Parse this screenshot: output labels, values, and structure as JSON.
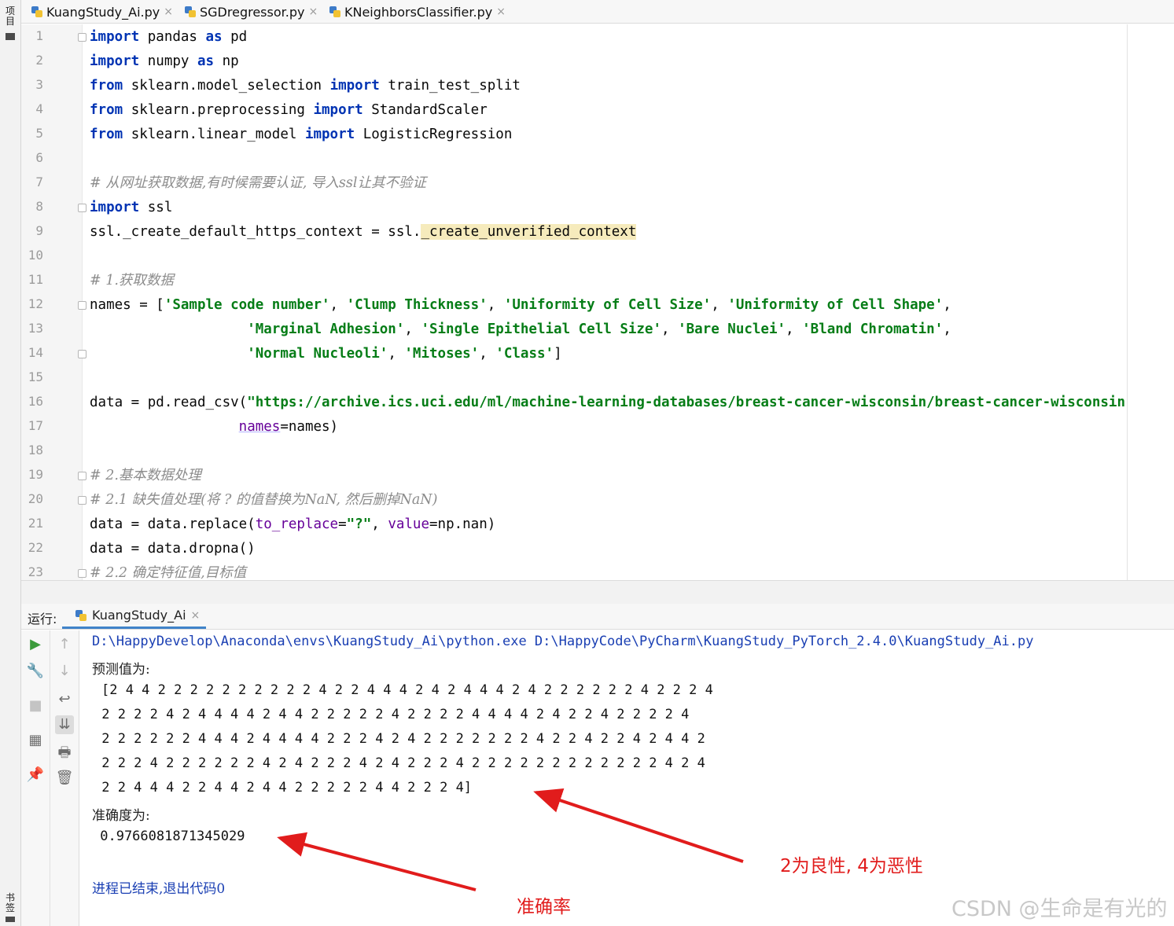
{
  "left_strip": {
    "top_label": "项目",
    "bottom_label": "书签"
  },
  "tabs": [
    {
      "label": "KuangStudy_Ai.py",
      "close": "×"
    },
    {
      "label": "SGDregressor.py",
      "close": "×"
    },
    {
      "label": "KNeighborsClassifier.py",
      "close": "×"
    }
  ],
  "editor": {
    "line_numbers": [
      "1",
      "2",
      "3",
      "4",
      "5",
      "6",
      "7",
      "8",
      "9",
      "10",
      "11",
      "12",
      "13",
      "14",
      "15",
      "16",
      "17",
      "18",
      "19",
      "20",
      "21",
      "22",
      "23"
    ],
    "lines": [
      {
        "kw1": "import",
        "t1": " pandas ",
        "kw2": "as",
        "t2": " pd"
      },
      {
        "kw1": "import",
        "t1": " numpy ",
        "kw2": "as",
        "t2": " np"
      },
      {
        "kw1": "from",
        "t1": " sklearn.model_selection ",
        "kw2": "import",
        "t2": " train_test_split"
      },
      {
        "kw1": "from",
        "t1": " sklearn.preprocessing ",
        "kw2": "import",
        "t2": " StandardScaler"
      },
      {
        "kw1": "from",
        "t1": " sklearn.linear_model ",
        "kw2": "import",
        "t2": " LogisticRegression"
      },
      {
        "comment": "# 从网址获取数据,有时候需要认证, 导入ssl让其不验证"
      },
      {
        "kw1": "import",
        "t1": " ssl"
      },
      {
        "t1": "ssl._create_default_https_context = ssl.",
        "hl": "_create_unverified_context"
      },
      {
        "comment": "# 1.获取数据"
      },
      {
        "t1": "names = [",
        "s1": "'Sample code number'",
        "t2": ", ",
        "s2": "'Clump Thickness'",
        "t3": ", ",
        "s3": "'Uniformity of Cell Size'",
        "t4": ", ",
        "s4": "'Uniformity of Cell Shape'",
        "t5": ","
      },
      {
        "t1": "                   ",
        "s1": "'Marginal Adhesion'",
        "t2": ", ",
        "s2": "'Single Epithelial Cell Size'",
        "t3": ", ",
        "s3": "'Bare Nuclei'",
        "t4": ", ",
        "s4": "'Bland Chromatin'",
        "t5": ","
      },
      {
        "t1": "                   ",
        "s1": "'Normal Nucleoli'",
        "t2": ", ",
        "s2": "'Mitoses'",
        "t3": ", ",
        "s3": "'Class'",
        "t4": "]"
      },
      {
        "t1": "data = pd.read_csv(",
        "s1": "\"https://archive.ics.uci.edu/ml/machine-learning-databases/breast-cancer-wisconsin/breast-cancer-wisconsin"
      },
      {
        "t1": "                  ",
        "p1": "names",
        "t2": "=names)"
      },
      {
        "comment": "# 2.基本数据处理"
      },
      {
        "comment": "# 2.1 缺失值处理(将 ? 的值替换为NaN, 然后删掉NaN)"
      },
      {
        "t1": "data = data.replace(",
        "p1": "to_replace",
        "t2": "=",
        "s1": "\"?\"",
        "t3": ", ",
        "p2": "value",
        "t4": "=np.nan)"
      },
      {
        "t1": "data = data.dropna()"
      },
      {
        "comment": "# 2.2 确定特征值,目标值"
      }
    ]
  },
  "run_panel": {
    "label": "运行:",
    "tab_label": "KuangStudy_Ai",
    "tab_close": "×",
    "console": {
      "command": "D:\\HappyDevelop\\Anaconda\\envs\\KuangStudy_Ai\\python.exe D:\\HappyCode\\PyCharm\\KuangStudy_PyTorch_2.4.0\\KuangStudy_Ai.py",
      "pred_label": "预测值为:",
      "pred_rows": [
        "[2 4 4 2 2 2 2 2 2 2 2 2 2 4 2 2 4 4 4 2 4 2 4 4 4 2 4 2 2 2 2 2 2 4 2 2 2 4",
        " 2 2 2 2 4 2 4 4 4 4 2 4 4 2 2 2 2 2 4 2 2 2 2 4 4 4 4 2 4 2 2 4 2 2 2 2 4",
        " 2 2 2 2 2 2 4 4 4 2 4 4 4 4 2 2 2 4 2 4 2 2 2 2 2 2 2 4 2 2 4 2 2 4 2 4 4 2",
        " 2 2 2 4 2 2 2 2 2 2 4 2 4 2 2 2 4 2 4 2 2 2 4 2 2 2 2 2 2 2 2 2 2 2 2 4 2 4",
        " 2 2 4 4 4 2 2 4 4 2 4 4 2 2 2 2 2 4 4 2 2 2 4]"
      ],
      "acc_label": "准确度为:",
      "acc_value": " 0.9766081871345029",
      "exit": "进程已结束,退出代码0"
    }
  },
  "annotations": {
    "label_class": "2为良性, 4为恶性",
    "label_accuracy": "准确率",
    "color": "#e11c1c"
  },
  "watermark": "CSDN @生命是有光的"
}
